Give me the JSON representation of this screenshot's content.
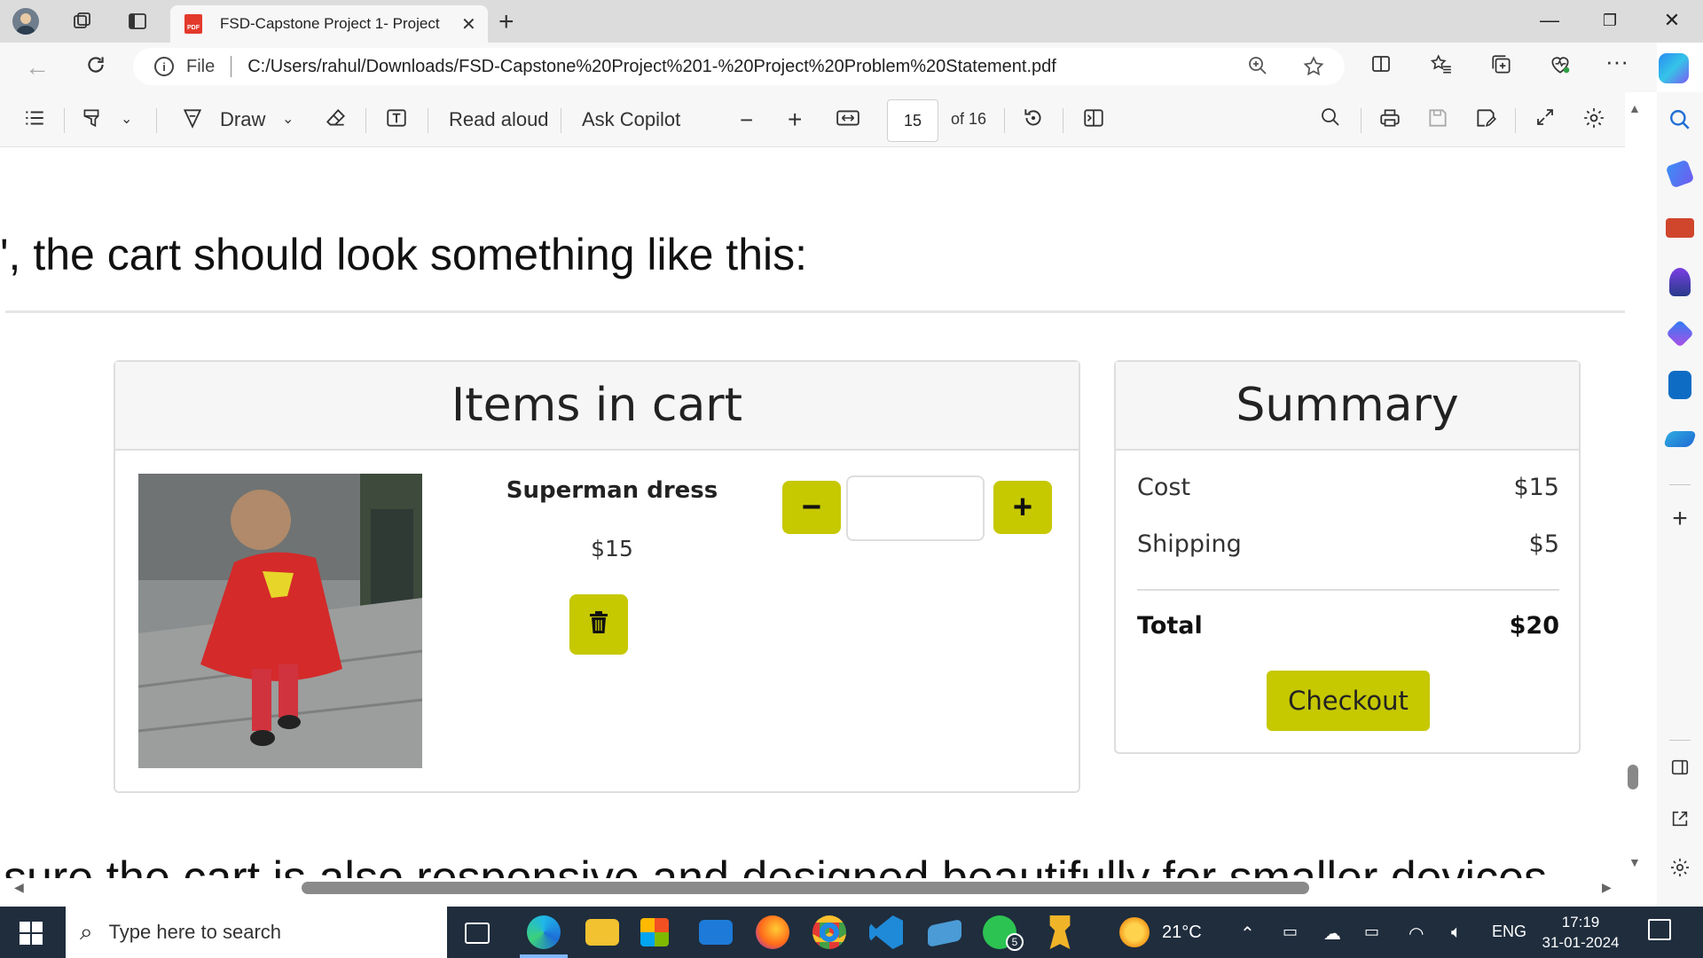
{
  "browser": {
    "tab_title": "FSD-Capstone Project 1- Project",
    "tab_badge": "PDF",
    "address_prefix": "File",
    "url": "C:/Users/rahul/Downloads/FSD-Capstone%20Project%201-%20Project%20Problem%20Statement.pdf"
  },
  "pdf_toolbar": {
    "draw_label": "Draw",
    "read_aloud_label": "Read aloud",
    "ask_copilot_label": "Ask Copilot",
    "current_page": "15",
    "total_pages_label": "of 16"
  },
  "document": {
    "heading": "', the cart should look something like this:",
    "bottom_text": "sure the cart is also responsive and designed beautifully for smaller devices",
    "cart": {
      "title": "Items in cart",
      "item_name": "Superman dress",
      "item_price": "$15",
      "minus_label": "−",
      "plus_label": "+",
      "quantity_value": ""
    },
    "summary": {
      "title": "Summary",
      "cost_label": "Cost",
      "cost_value": "$15",
      "shipping_label": "Shipping",
      "shipping_value": "$5",
      "total_label": "Total",
      "total_value": "$20",
      "checkout_label": "Checkout"
    }
  },
  "taskbar": {
    "search_placeholder": "Type here to search",
    "weather_temp": "21°C",
    "language": "ENG",
    "time": "17:19",
    "date": "31-01-2024",
    "whatsapp_badge": "5"
  },
  "colors": {
    "accent_yellow": "#c6c800",
    "taskbar_bg": "#1f2d3d"
  }
}
